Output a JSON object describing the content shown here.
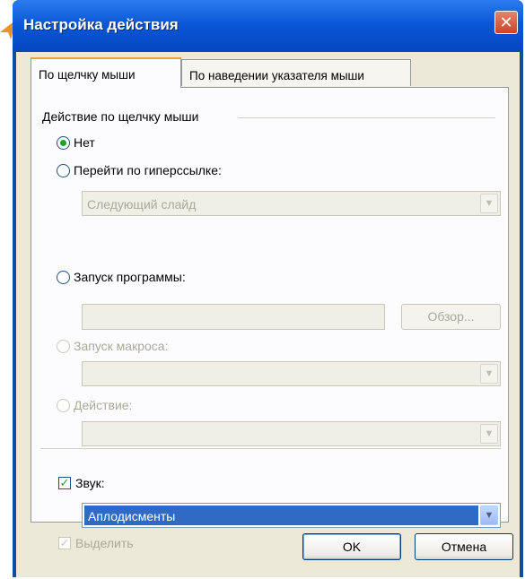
{
  "dialog": {
    "title": "Настройка действия",
    "close_label": "✕"
  },
  "tabs": [
    {
      "label": "По щелчку мыши",
      "active": true
    },
    {
      "label": "По наведении указателя мыши",
      "active": false
    }
  ],
  "group": {
    "label": "Действие по щелчку мыши"
  },
  "options": {
    "none": {
      "label": "Нет",
      "selected": true
    },
    "hyperlink": {
      "label": "Перейти по гиперссылке:",
      "selected": false,
      "value": "Следующий слайд"
    },
    "run_program": {
      "label": "Запуск программы:",
      "selected": false,
      "value": "",
      "browse_label": "Обзор..."
    },
    "run_macro": {
      "label": "Запуск макроса:",
      "enabled": false,
      "value": ""
    },
    "object_action": {
      "label": "Действие:",
      "enabled": false,
      "value": ""
    }
  },
  "sound": {
    "label": "Звук:",
    "checked": true,
    "value": "Аплодисменты"
  },
  "highlight": {
    "label": "Выделить",
    "checked": true,
    "enabled": false
  },
  "buttons": {
    "ok": "OK",
    "cancel": "Отмена"
  },
  "colors": {
    "title_bar": "#0a58d8",
    "selection": "#316ac5",
    "tab_highlight": "#f0a030",
    "accent_arrow": "#f0902a"
  }
}
